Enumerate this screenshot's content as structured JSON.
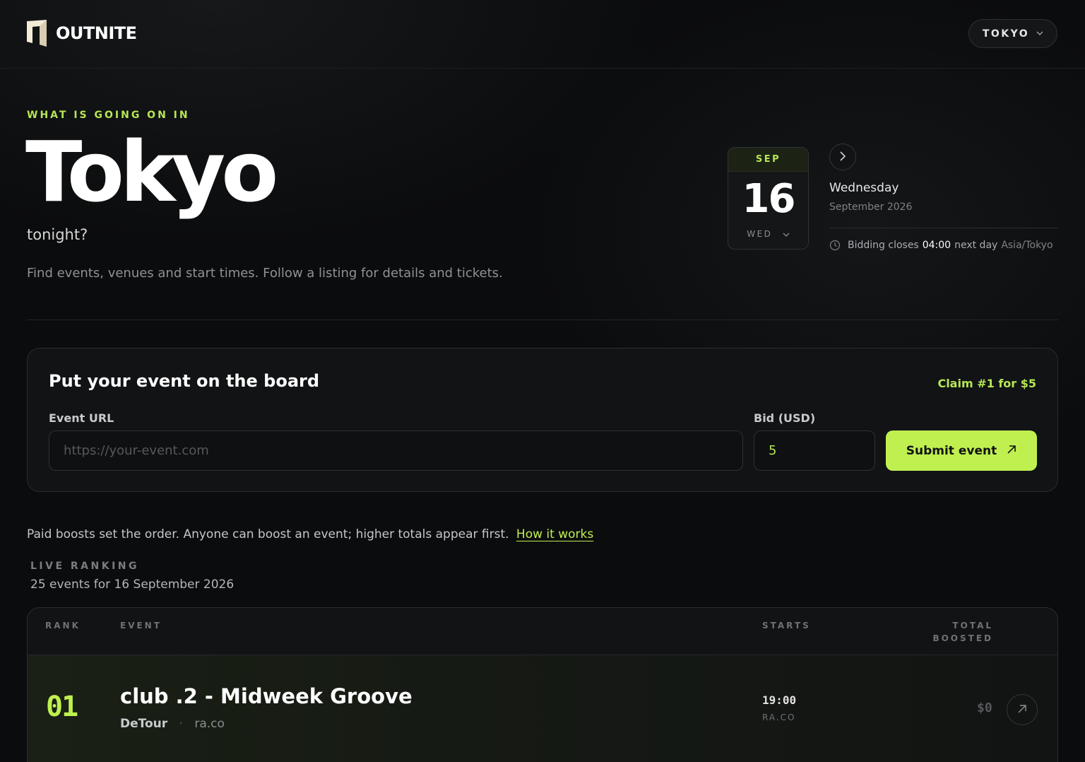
{
  "header": {
    "brand": "OUTNITE",
    "city_select": "TOKYO"
  },
  "hero": {
    "eyebrow": "WHAT IS GOING ON IN",
    "city": "Tokyo",
    "subtitle": "tonight?",
    "tagline": "Find events, venues and start times. Follow a listing for details and tickets."
  },
  "date": {
    "month": "SEP",
    "day": "16",
    "dow": "WED",
    "weekday": "Wednesday",
    "month_year": "September 2026",
    "bidding_prefix": "Bidding closes",
    "bidding_time": "04:00",
    "bidding_suffix": "next day",
    "timezone": "Asia/Tokyo"
  },
  "board": {
    "title": "Put your event on the board",
    "claim": "Claim #1 for $5",
    "url_label": "Event URL",
    "url_placeholder": "https://your-event.com",
    "bid_label": "Bid (USD)",
    "bid_value": "5",
    "submit_label": "Submit event"
  },
  "ranking": {
    "note": "Paid boosts set the order. Anyone can boost an event; higher totals appear first.",
    "how_link": "How it works",
    "live_label": "LIVE RANKING",
    "count": "25 events for 16 September 2026",
    "headers": {
      "rank": "RANK",
      "event": "EVENT",
      "starts": "STARTS",
      "total_line1": "TOTAL",
      "total_line2": "BOOSTED"
    },
    "rows": [
      {
        "rank": "01",
        "title": "club .2 - Midweek Groove",
        "venue": "DeTour",
        "separator": "·",
        "source": "ra.co",
        "start": "19:00",
        "start_source": "RA.CO",
        "boosted": "$0"
      }
    ]
  },
  "colors": {
    "accent": "#c0f050",
    "background": "#0b0c0d",
    "panel": "#111315"
  }
}
